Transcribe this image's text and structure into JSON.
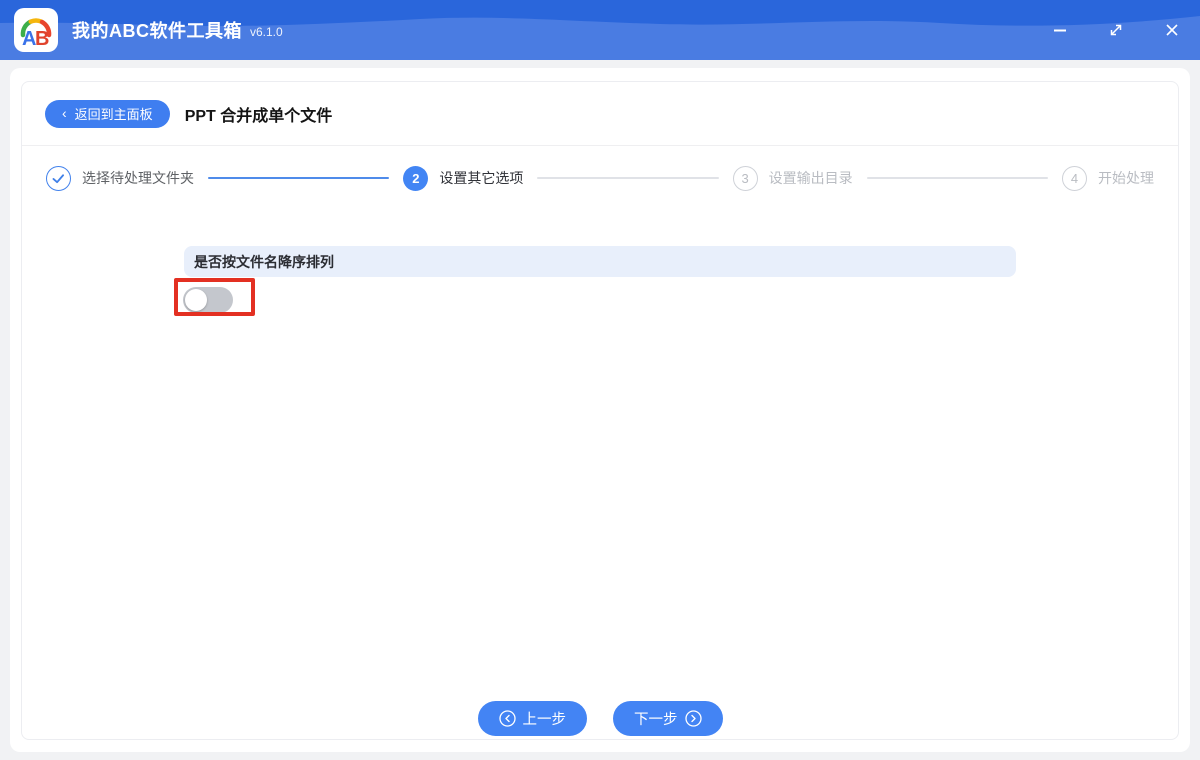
{
  "titlebar": {
    "app_title": "我的ABC软件工具箱",
    "version": "v6.1.0",
    "icon_letters": {
      "a": "A",
      "b": "B"
    }
  },
  "header": {
    "back_chevron": "‹",
    "back_label": "返回到主面板",
    "page_title": "PPT 合并成单个文件"
  },
  "steps": [
    {
      "num": "",
      "label": "选择待处理文件夹",
      "state": "done"
    },
    {
      "num": "2",
      "label": "设置其它选项",
      "state": "active"
    },
    {
      "num": "3",
      "label": "设置输出目录",
      "state": "pending"
    },
    {
      "num": "4",
      "label": "开始处理",
      "state": "pending"
    }
  ],
  "option": {
    "label": "是否按文件名降序排列",
    "toggle_state": "off"
  },
  "footer": {
    "prev_label": "上一步",
    "next_label": "下一步"
  },
  "colors": {
    "titlebar_top": "#2a66db",
    "titlebar_bottom": "#4a7ce2",
    "accent_blue": "#4285f4",
    "option_bg": "#e8effb",
    "toggle_track_off": "#c4c7cd",
    "highlight_red": "#e33022",
    "page_bg": "#f1f2f4"
  }
}
